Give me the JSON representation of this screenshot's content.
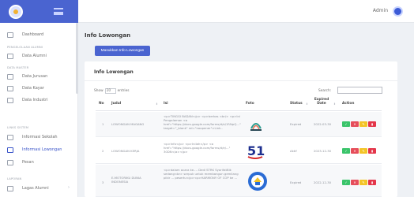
{
  "header": {
    "user_label": "Admin"
  },
  "sidebar": {
    "items": [
      {
        "label": "Dashboard",
        "icon": "dashboard-icon"
      },
      {
        "label": "Data Alumni",
        "icon": "users-icon"
      },
      {
        "label": "Data Jurusan",
        "icon": "book-icon"
      },
      {
        "label": "Data Kayar",
        "icon": "briefcase-icon"
      },
      {
        "label": "Data Industri",
        "icon": "building-icon"
      },
      {
        "label": "Informasi Sekolah",
        "icon": "school-icon"
      },
      {
        "label": "Informasi Lowongan",
        "icon": "job-icon"
      },
      {
        "label": "Pesan",
        "icon": "message-icon"
      },
      {
        "label": "Lagas Alumni",
        "icon": "report-icon"
      }
    ],
    "sections": [
      "PENGELOLAAN ALUMNI",
      "DATA MASTER",
      "LINKS SISTEM",
      "LAPORAN"
    ]
  },
  "main": {
    "page_title": "Info Lowongan",
    "add_button": "Masukkan Info Lowongan"
  },
  "table": {
    "title": "Info Lowongan",
    "show_label": "Show",
    "show_value": "10",
    "entries_label": "entries",
    "search_label": "Search:",
    "columns": [
      "No",
      "Judul",
      "Isi",
      "Foto",
      "Status",
      "Expired Date",
      "Action"
    ],
    "rows": [
      {
        "no": "1",
        "judul": "LOWONGAN MAGANG",
        "isi": "<p>TINGGI BADAN</p> <p>berkas <br/> <p>Ini Pengalaman <a href=\"https://docs.google.com/forms/d/e/1FAIpQ...\" target=\"_blank\" rel=\"noopener\">Link..",
        "status": "Expired",
        "expired": "2022-03-30"
      },
      {
        "no": "2",
        "judul": "LOWONGAN KERJA",
        "isi": "<p>Info</p> <p>Inilah</p> <a href=\"https://docs.google.com/forms/d/e/...\" 30DN</a></p>",
        "status": "Aktif",
        "expired": "2023-12-30"
      },
      {
        "no": "3",
        "judul": "E-MOTORIKU DUNIA INDONESIA",
        "isi": "<p>dalam acara ke-... Dedi STRK SyarifatBik sedang<br> serpuk untuk membangun gemilang pikir ... pesertu</p><p>HARMONY OF COP ke ...",
        "status": "Expired",
        "expired": "2022-12-30"
      }
    ]
  }
}
